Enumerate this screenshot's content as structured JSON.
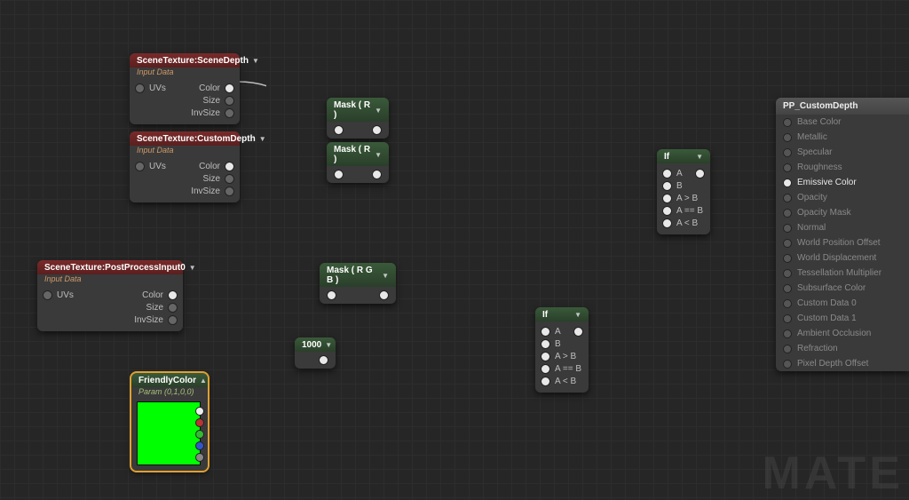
{
  "scene_depth": {
    "title": "SceneTexture:SceneDepth",
    "sub": "Input Data",
    "in": "UVs",
    "out1": "Color",
    "out2": "Size",
    "out3": "InvSize"
  },
  "custom_depth": {
    "title": "SceneTexture:CustomDepth",
    "sub": "Input Data",
    "in": "UVs",
    "out1": "Color",
    "out2": "Size",
    "out3": "InvSize"
  },
  "pp_input": {
    "title": "SceneTexture:PostProcessInput0",
    "sub": "Input Data",
    "in": "UVs",
    "out1": "Color",
    "out2": "Size",
    "out3": "InvSize"
  },
  "mask1": {
    "title": "Mask ( R )"
  },
  "mask2": {
    "title": "Mask ( R )"
  },
  "mask3": {
    "title": "Mask ( R G B )"
  },
  "const": {
    "title": "1000"
  },
  "friendly": {
    "title": "FriendlyColor",
    "sub": "Param (0,1,0,0)"
  },
  "if1": {
    "title": "If",
    "p1": "A",
    "p2": "B",
    "p3": "A > B",
    "p4": "A == B",
    "p5": "A < B"
  },
  "if2": {
    "title": "If",
    "p1": "A",
    "p2": "B",
    "p3": "A > B",
    "p4": "A == B",
    "p5": "A < B"
  },
  "out": {
    "title": "PP_CustomDepth",
    "rows": [
      "Base Color",
      "Metallic",
      "Specular",
      "Roughness",
      "Emissive Color",
      "Opacity",
      "Opacity Mask",
      "Normal",
      "World Position Offset",
      "World Displacement",
      "Tessellation Multiplier",
      "Subsurface Color",
      "Custom Data 0",
      "Custom Data 1",
      "Ambient Occlusion",
      "Refraction",
      "Pixel Depth Offset"
    ],
    "active": "Emissive Color"
  },
  "watermark": "MATE"
}
